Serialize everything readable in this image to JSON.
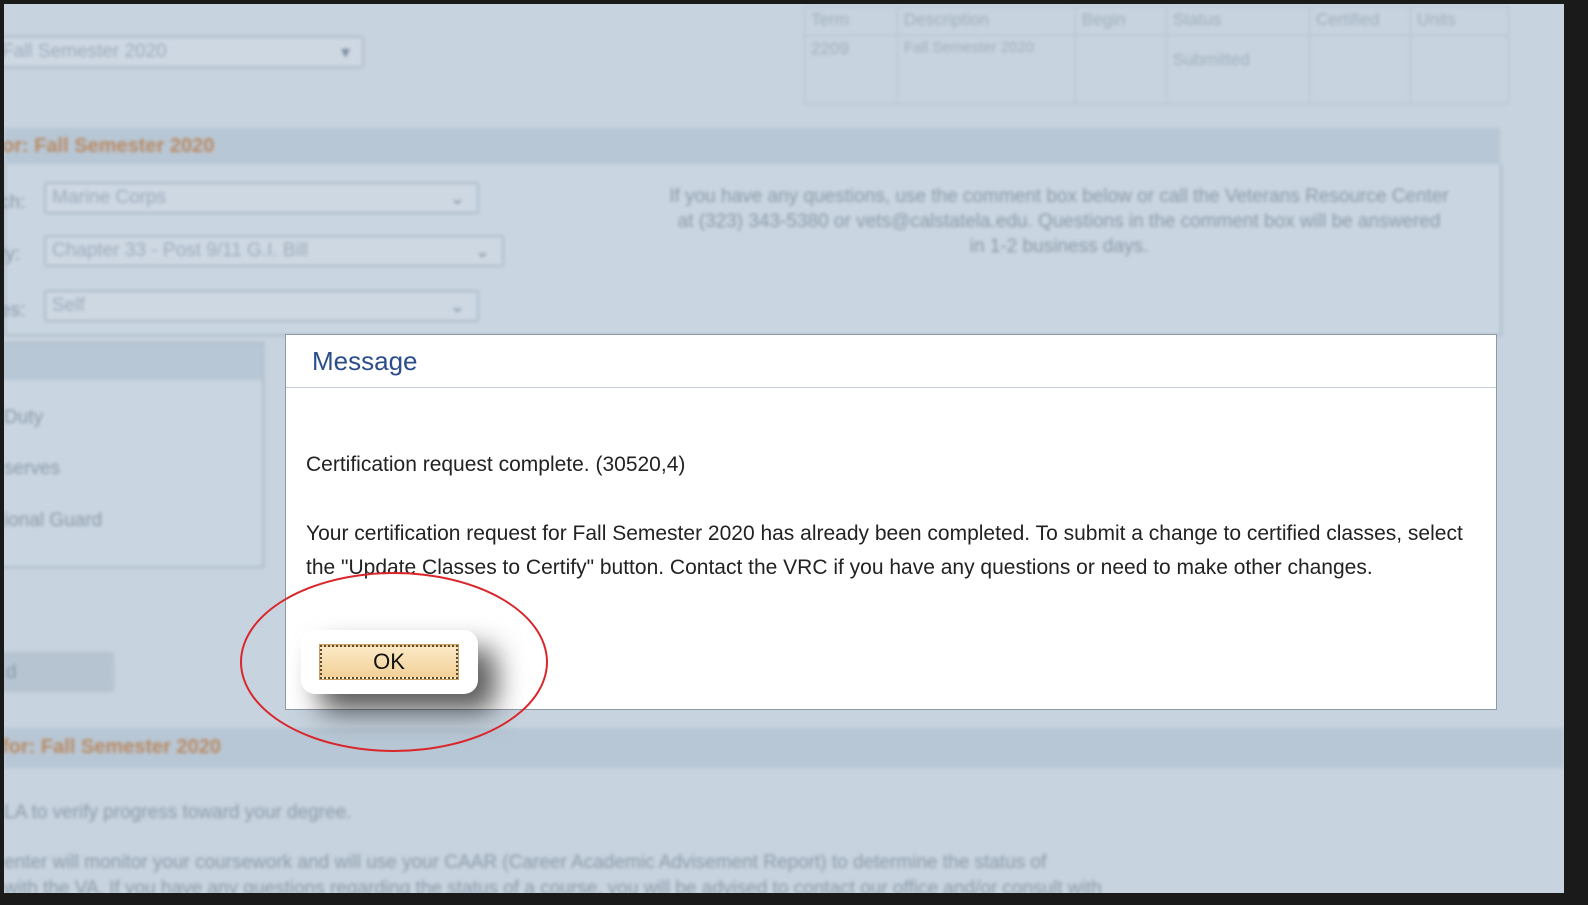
{
  "background": {
    "term_dropdown": "Fall Semester 2020",
    "term_table": {
      "headers": [
        "Term",
        "Description",
        "Begin",
        "Status",
        "Certified",
        "Units"
      ],
      "rows": [
        [
          "2209",
          "Fall Semester 2020",
          "",
          "Submitted",
          "",
          ""
        ]
      ]
    },
    "section_title_1": "or: Fall Semester 2020",
    "fields": [
      {
        "label": "ch:",
        "value": "Marine Corps"
      },
      {
        "label": "ty:",
        "value": "Chapter 33 - Post 9/11 G.I. Bill"
      },
      {
        "label": "es:",
        "value": "Self"
      }
    ],
    "info_text": "If you have any questions, use the comment box below or call the Veterans Resource Center at (323) 343-5380 or vets@calstatela.edu. Questions in the comment box will be answered in 1-2 business days.",
    "side_items": [
      "Duty",
      "serves",
      "ional Guard"
    ],
    "side_button": "d",
    "section_title_2": "for: Fall Semester 2020",
    "para_1": "LA to verify progress toward your degree.",
    "para_2": "enter will monitor your coursework and will use your CAAR (Career Academic Advisement Report) to determine the status of",
    "para_3": "with the VA. If you have any questions regarding the status of a course, you will be advised to contact our office and/or consult with"
  },
  "dialog": {
    "title": "Message",
    "line1": "Certification request complete. (30520,4)",
    "body": "Your certification request for Fall Semester 2020 has already been completed. To submit a change to certified classes, select the \"Update Classes to Certify\" button. Contact the VRC if you have any questions or need to make other changes.",
    "ok_label": "OK"
  },
  "colors": {
    "dialog_title": "#2c4f8a",
    "highlight_ring": "#d9262b",
    "ok_button": "#f2d197"
  }
}
